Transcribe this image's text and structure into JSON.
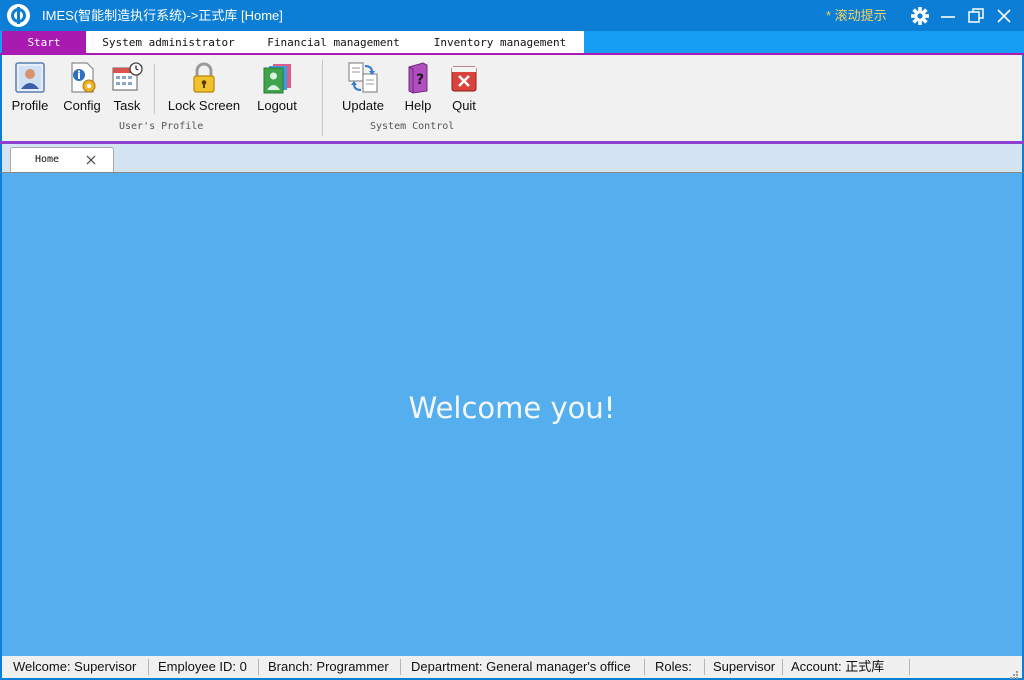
{
  "window": {
    "title": "IMES(智能制造执行系统)->正式库 [Home]",
    "scroll_hint": "* 滚动提示",
    "accent_color": "#0c7ed6",
    "controls": [
      "gear-icon",
      "minimize-icon",
      "restore-icon",
      "close-icon"
    ]
  },
  "menu": {
    "tabs": [
      {
        "label": "Start"
      },
      {
        "label": "System administrator"
      },
      {
        "label": "Financial management"
      },
      {
        "label": "Inventory management"
      }
    ],
    "active_tab": "Start",
    "active_color": "#a91bb0"
  },
  "ribbon": {
    "groups": [
      {
        "label": "User's Profile",
        "buttons": [
          {
            "label": "Profile",
            "icon": "profile-icon"
          },
          {
            "label": "Config",
            "icon": "config-icon"
          },
          {
            "label": "Task",
            "icon": "task-icon"
          },
          {
            "label": "Lock Screen",
            "icon": "lock-icon"
          },
          {
            "label": "Logout",
            "icon": "logout-icon"
          }
        ]
      },
      {
        "label": "System Control",
        "buttons": [
          {
            "label": "Update",
            "icon": "update-icon"
          },
          {
            "label": "Help",
            "icon": "help-icon"
          },
          {
            "label": "Quit",
            "icon": "quit-icon"
          }
        ]
      }
    ]
  },
  "doc_tabs": [
    {
      "label": "Home",
      "closable": true
    }
  ],
  "main": {
    "welcome_text": "Welcome you!",
    "background_color": "#55aeee"
  },
  "statusbar": {
    "welcome": "Welcome: Supervisor",
    "employee_id": "Employee ID: 0",
    "branch": "Branch: Programmer",
    "department": "Department: General manager's office",
    "roles_label": "Roles:",
    "roles_value": "Supervisor",
    "account": "Account: 正式库"
  }
}
